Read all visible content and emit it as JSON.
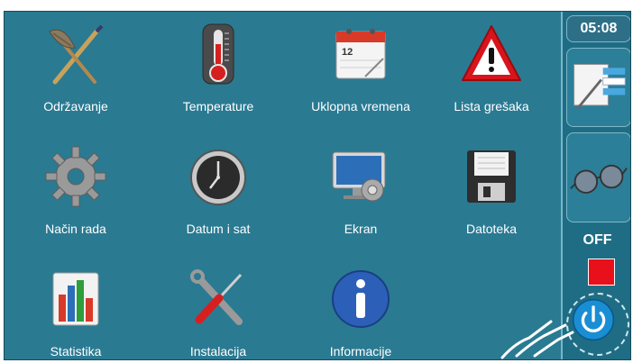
{
  "screen": {
    "background": "#2a7a92",
    "tiles": [
      {
        "label": "Održavanje",
        "icon": "maintenance-tools-icon"
      },
      {
        "label": "Temperature",
        "icon": "thermometer-icon"
      },
      {
        "label": "Uklopna vremena",
        "icon": "calendar-icon"
      },
      {
        "label": "Lista grešaka",
        "icon": "warning-triangle-icon"
      },
      {
        "label": "Način rada",
        "icon": "gear-icon"
      },
      {
        "label": "Datum i sat",
        "icon": "clock-icon"
      },
      {
        "label": "Ekran",
        "icon": "display-settings-icon"
      },
      {
        "label": "Datoteka",
        "icon": "floppy-disk-icon"
      },
      {
        "label": "Statistika",
        "icon": "bar-chart-icon"
      },
      {
        "label": "Instalacija",
        "icon": "wrench-screwdriver-icon"
      },
      {
        "label": "Informacije",
        "icon": "info-icon"
      }
    ]
  },
  "sidebar": {
    "time": "05:08",
    "status": "OFF",
    "buttons": [
      "edit-list-icon",
      "glasses-icon",
      "power-icon"
    ],
    "stop_color": "#e8101a"
  }
}
